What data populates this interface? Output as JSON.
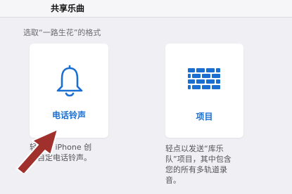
{
  "header": {
    "title": "共享乐曲"
  },
  "section": {
    "label": "选取“一路生花”的格式"
  },
  "options": {
    "ringtone": {
      "label": "电话铃声",
      "icon": "bell-icon",
      "description_lines": [
        "轻点为 iPhone 创",
        "建自定电话铃声。"
      ]
    },
    "project": {
      "label": "项目",
      "icon": "wall-icon",
      "description_lines": [
        "轻点以发送“库乐",
        "队”项目，其中包含",
        "您的所有多轨道录",
        "音。"
      ]
    }
  },
  "annotation": {
    "icon": "pointer-arrow-icon",
    "color": "#a0302c"
  },
  "colors": {
    "accent": "#1a6fd1",
    "background": "#efeff4"
  }
}
